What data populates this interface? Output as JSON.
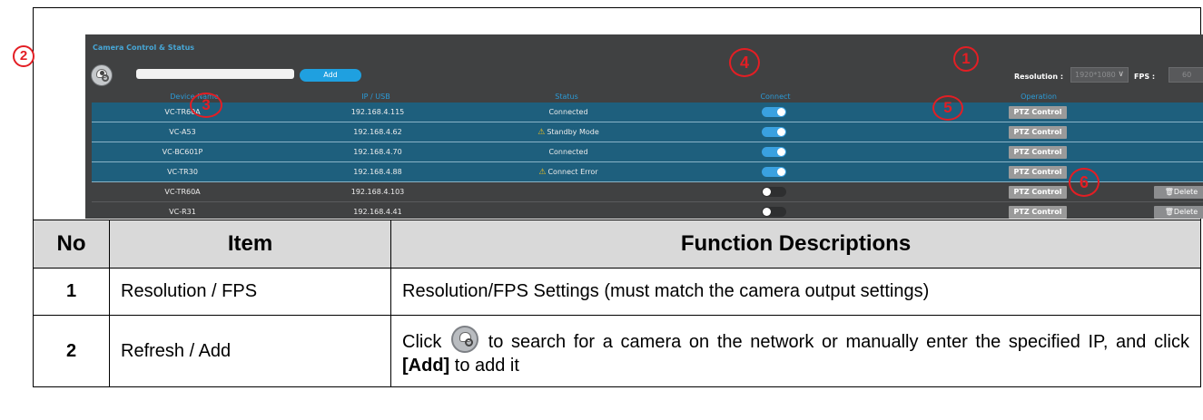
{
  "panel": {
    "title": "Camera Control & Status",
    "ip_input_value": "",
    "add_label": "Add",
    "resolution_label": "Resolution :",
    "resolution_value": "1920*1080",
    "fps_label": "FPS :",
    "fps_value": "60",
    "columns": [
      "Device Name",
      "IP / USB",
      "Status",
      "Connect",
      "Operation"
    ],
    "rows": [
      {
        "name": "VC-TR60A",
        "ip": "192.168.4.115",
        "status": "Connected",
        "warning": false,
        "connected": true,
        "ptz": "PTZ Control",
        "delete": ""
      },
      {
        "name": "VC-A53",
        "ip": "192.168.4.62",
        "status": "Standby Mode",
        "warning": true,
        "connected": true,
        "ptz": "PTZ Control",
        "delete": ""
      },
      {
        "name": "VC-BC601P",
        "ip": "192.168.4.70",
        "status": "Connected",
        "warning": false,
        "connected": true,
        "ptz": "PTZ Control",
        "delete": ""
      },
      {
        "name": "VC-TR30",
        "ip": "192.168.4.88",
        "status": "Connect Error",
        "warning": true,
        "connected": true,
        "ptz": "PTZ Control",
        "delete": ""
      },
      {
        "name": "VC-TR60A",
        "ip": "192.168.4.103",
        "status": "",
        "warning": false,
        "connected": false,
        "ptz": "PTZ Control",
        "delete": "Delete"
      },
      {
        "name": "VC-R31",
        "ip": "192.168.4.41",
        "status": "",
        "warning": false,
        "connected": false,
        "ptz": "PTZ Control",
        "delete": "Delete"
      }
    ]
  },
  "callouts": [
    "1",
    "2",
    "3",
    "4",
    "5",
    "6"
  ],
  "table": {
    "headers": [
      "No",
      "Item",
      "Function Descriptions"
    ],
    "rows": [
      {
        "no": "1",
        "item": "Resolution / FPS",
        "desc": "Resolution/FPS Settings (must match the camera output settings)"
      },
      {
        "no": "2",
        "item": "Refresh / Add",
        "desc_before": "Click",
        "desc_middle": "to search for a camera on the network or manually enter the specified IP, and click",
        "desc_bold": "[Add]",
        "desc_after": "to add it"
      }
    ]
  },
  "colors": {
    "accent": "#1fa0e0",
    "highlight_row": "#1e5f7d",
    "panel_bg": "#404142",
    "callout": "#e31e24",
    "warning": "#f3c01c"
  },
  "icons": [
    "refresh-camera-icon",
    "warning-icon",
    "trash-icon",
    "chevron-down-icon",
    "scroll-up-icon"
  ]
}
